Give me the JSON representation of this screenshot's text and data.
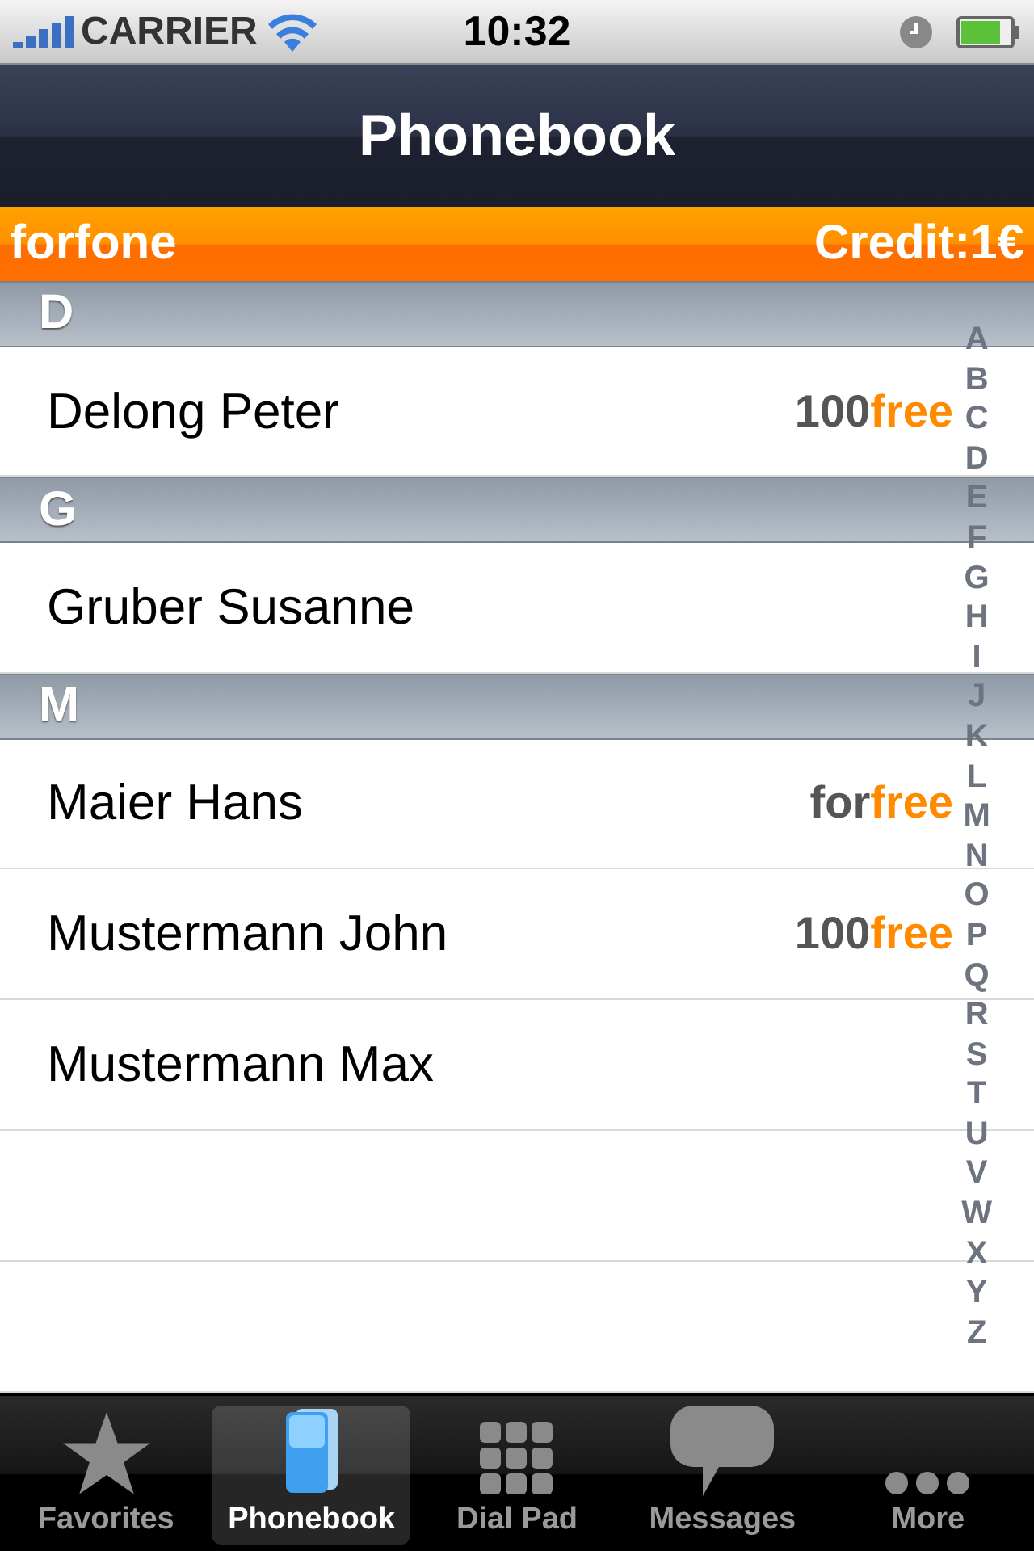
{
  "status_bar": {
    "carrier": "CARRIER",
    "time": "10:32"
  },
  "nav_bar": {
    "title": "Phonebook"
  },
  "banner": {
    "brand": "forfone",
    "credit": "Credit:1€"
  },
  "sections": [
    {
      "letter": "D",
      "contacts": [
        {
          "name": "Delong Peter",
          "badge": {
            "prefix": "100",
            "suffix": "free"
          }
        }
      ]
    },
    {
      "letter": "G",
      "contacts": [
        {
          "name": "Gruber Susanne"
        }
      ]
    },
    {
      "letter": "M",
      "contacts": [
        {
          "name": "Maier Hans",
          "badge": {
            "prefix": "for",
            "suffix": "free"
          }
        },
        {
          "name": "Mustermann John",
          "badge": {
            "prefix": "100",
            "suffix": "free"
          }
        },
        {
          "name": "Mustermann Max"
        }
      ]
    }
  ],
  "index": [
    "A",
    "B",
    "C",
    "D",
    "E",
    "F",
    "G",
    "H",
    "I",
    "J",
    "K",
    "L",
    "M",
    "N",
    "O",
    "P",
    "Q",
    "R",
    "S",
    "T",
    "U",
    "V",
    "W",
    "X",
    "Y",
    "Z"
  ],
  "tabs": [
    {
      "label": "Favorites",
      "kind": "star",
      "selected": false
    },
    {
      "label": "Phonebook",
      "kind": "book",
      "selected": true
    },
    {
      "label": "Dial Pad",
      "kind": "grid",
      "selected": false
    },
    {
      "label": "Messages",
      "kind": "bubble",
      "selected": false
    },
    {
      "label": "More",
      "kind": "dots",
      "selected": false
    }
  ]
}
